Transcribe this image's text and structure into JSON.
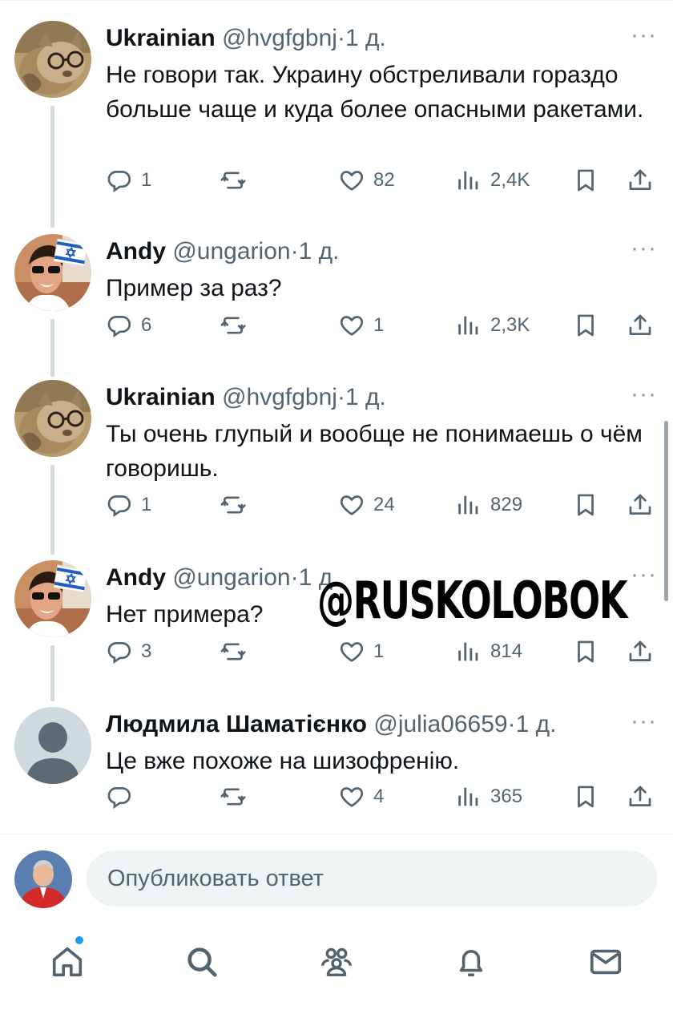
{
  "tweets": [
    {
      "name": "Ukrainian",
      "handle": "@hvgfgbnj",
      "separator": "·",
      "time": "1 д.",
      "more": "···",
      "text": "Не говори так. Украину обстреливали гораздо больше чаще и куда более опасными ракетами.",
      "reply_count": "1",
      "retweet_count": "",
      "like_count": "82",
      "view_count": "2,4K",
      "avatar": "cat-with-glasses-avatar"
    },
    {
      "name": "Andy",
      "handle": "@ungarion",
      "separator": "·",
      "time": "1 д.",
      "more": "···",
      "text": "Пример за раз?",
      "reply_count": "6",
      "retweet_count": "",
      "like_count": "1",
      "view_count": "2,3K",
      "avatar": "man-with-israel-flag-avatar"
    },
    {
      "name": "Ukrainian",
      "handle": "@hvgfgbnj",
      "separator": "·",
      "time": "1 д.",
      "more": "···",
      "text": "Ты очень глупый и вообще не понимаешь о чём говоришь.",
      "reply_count": "1",
      "retweet_count": "",
      "like_count": "24",
      "view_count": "829",
      "avatar": "cat-with-glasses-avatar"
    },
    {
      "name": "Andy",
      "handle": "@ungarion",
      "separator": "·",
      "time": "1 д.",
      "more": "···",
      "text": "Нет примера?",
      "reply_count": "3",
      "retweet_count": "",
      "like_count": "1",
      "view_count": "814",
      "avatar": "man-with-israel-flag-avatar"
    },
    {
      "name": "Людмила Шаматієнко",
      "handle": "@julia06659",
      "separator": "·",
      "time": "1 д.",
      "more": "···",
      "text": "Це вже похоже на шизофренію.",
      "reply_count": "",
      "retweet_count": "",
      "like_count": "4",
      "view_count": "365",
      "avatar": "default-user-avatar"
    }
  ],
  "watermark": "@RUSKOLOBOK",
  "reply_box": {
    "placeholder": "Опубликовать ответ"
  },
  "nav": {
    "items": [
      "home-icon",
      "search-icon",
      "communities-icon",
      "notifications-icon",
      "messages-icon"
    ],
    "active_dot_color": "#1d9bf0"
  },
  "colors": {
    "text": "#0f1419",
    "secondary": "#536471",
    "thread_line": "#cfd9de",
    "input_bg": "#eff3f4"
  }
}
